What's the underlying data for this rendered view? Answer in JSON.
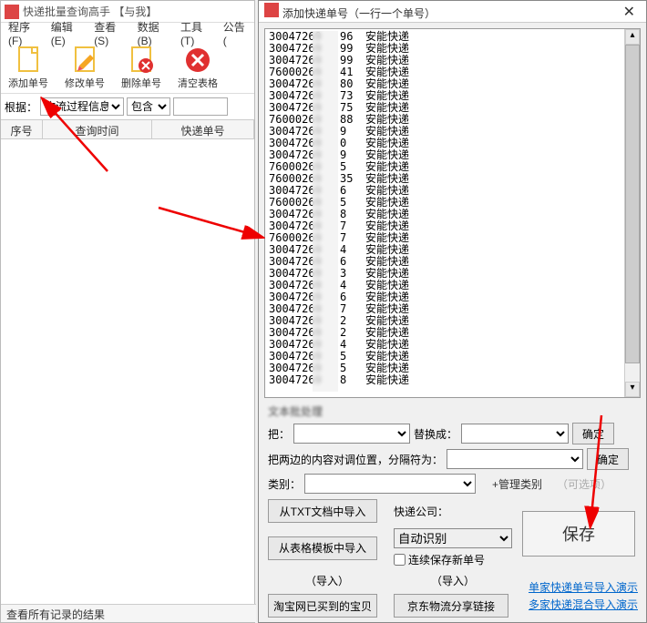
{
  "main": {
    "title": "快递批量查询高手 【与我】",
    "menu": [
      "程序(F)",
      "编辑(E)",
      "查看(S)",
      "数据(B)",
      "工具(T)",
      "公告("
    ],
    "toolbar": [
      {
        "name": "add",
        "label": "添加单号",
        "icon": "📄"
      },
      {
        "name": "edit",
        "label": "修改单号",
        "icon": "✏️"
      },
      {
        "name": "delete",
        "label": "删除单号",
        "icon": "✖"
      },
      {
        "name": "clear",
        "label": "清空表格",
        "icon": "⛔"
      }
    ],
    "filter": {
      "label": "根据：",
      "opt1": "物流过程信息",
      "opt2": "包含"
    },
    "columns": {
      "no": "序号",
      "time": "查询时间",
      "track": "快递单号"
    },
    "status": "查看所有记录的结果"
  },
  "dialog": {
    "title": "添加快递单号（一行一个单号）",
    "tracking": [
      [
        "30047269",
        "96",
        "安能快递"
      ],
      [
        "30047269",
        "99",
        "安能快递"
      ],
      [
        "30047269",
        "99",
        "安能快递"
      ],
      [
        "76000269",
        "41",
        "安能快递"
      ],
      [
        "30047269",
        "80",
        "安能快递"
      ],
      [
        "30047269",
        "73",
        "安能快递"
      ],
      [
        "30047269",
        "75",
        "安能快递"
      ],
      [
        "76000269",
        "88",
        "安能快递"
      ],
      [
        "30047269",
        "9",
        "安能快递"
      ],
      [
        "30047269",
        "0",
        "安能快递"
      ],
      [
        "30047269",
        "9",
        "安能快递"
      ],
      [
        "76000269",
        "5",
        "安能快递"
      ],
      [
        "76000269",
        "35",
        "安能快递"
      ],
      [
        "30047269",
        "6",
        "安能快递"
      ],
      [
        "76000269",
        "5",
        "安能快递"
      ],
      [
        "30047269",
        "8",
        "安能快递"
      ],
      [
        "30047269",
        "7",
        "安能快递"
      ],
      [
        "76000269",
        "7",
        "安能快递"
      ],
      [
        "30047269",
        "4",
        "安能快递"
      ],
      [
        "30047269",
        "6",
        "安能快递"
      ],
      [
        "30047269",
        "3",
        "安能快递"
      ],
      [
        "30047269",
        "4",
        "安能快递"
      ],
      [
        "30047269",
        "6",
        "安能快递"
      ],
      [
        "30047269",
        "7",
        "安能快递"
      ],
      [
        "30047269",
        "2",
        "安能快递"
      ],
      [
        "30047269",
        "2",
        "安能快递"
      ],
      [
        "30047269",
        "4",
        "安能快递"
      ],
      [
        "30047269",
        "5",
        "安能快递"
      ],
      [
        "30047269",
        "5",
        "安能快递"
      ],
      [
        "30047269",
        "8",
        "安能快递"
      ]
    ],
    "batch_label": "文本批处理",
    "replace_from": "把：",
    "replace_to": "替换成：",
    "swap_label": "把两边的内容对调位置，分隔符为：",
    "category_label": "类别：",
    "manage_cat": "+管理类别",
    "optional_hint": "（可选项）",
    "btn_txt_import": "从TXT文档中导入",
    "btn_tpl_import": "从表格模板中导入",
    "company_label": "快递公司：",
    "company_value": "自动识别",
    "continuous": "连续保存新单号",
    "import_hint": "（导入）",
    "btn_taobao": "淘宝网已买到的宝贝",
    "btn_jd": "京东物流分享链接",
    "save": "保存",
    "confirm": "确定",
    "demo1": "单家快递单号导入演示",
    "demo2": "多家快递混合导入演示"
  }
}
